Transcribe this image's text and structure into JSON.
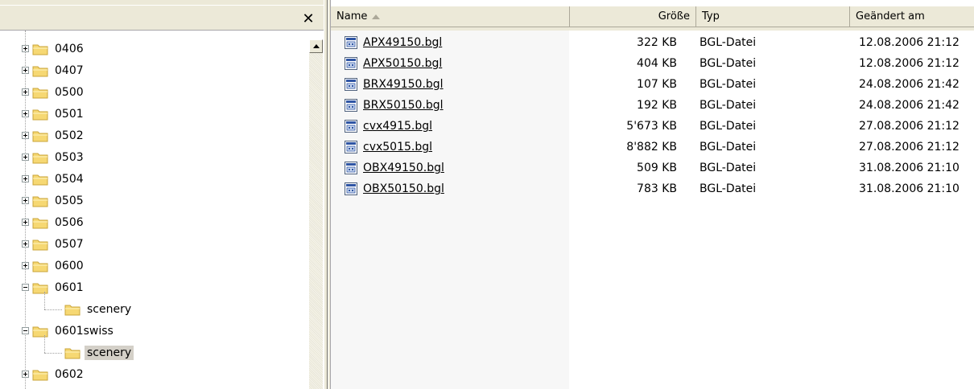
{
  "left_pane": {
    "close_glyph": "✕",
    "tree": [
      {
        "label": "0406",
        "expander": "plus"
      },
      {
        "label": "0407",
        "expander": "plus"
      },
      {
        "label": "0500",
        "expander": "plus"
      },
      {
        "label": "0501",
        "expander": "plus"
      },
      {
        "label": "0502",
        "expander": "plus"
      },
      {
        "label": "0503",
        "expander": "plus"
      },
      {
        "label": "0504",
        "expander": "plus"
      },
      {
        "label": "0505",
        "expander": "plus"
      },
      {
        "label": "0506",
        "expander": "plus"
      },
      {
        "label": "0507",
        "expander": "plus"
      },
      {
        "label": "0600",
        "expander": "plus"
      },
      {
        "label": "0601",
        "expander": "minus"
      },
      {
        "label": "scenery",
        "expander": "none",
        "child": true
      },
      {
        "label": "0601swiss",
        "expander": "minus"
      },
      {
        "label": "scenery",
        "expander": "none",
        "child": true,
        "selected": true
      },
      {
        "label": "0602",
        "expander": "plus"
      }
    ]
  },
  "file_list": {
    "columns": {
      "name": "Name",
      "size": "Größe",
      "type": "Typ",
      "modified": "Geändert am"
    },
    "files": [
      {
        "name": "APX49150.bgl",
        "size": "322 KB",
        "type": "BGL-Datei",
        "modified": "12.08.2006 21:12"
      },
      {
        "name": "APX50150.bgl",
        "size": "404 KB",
        "type": "BGL-Datei",
        "modified": "12.08.2006 21:12"
      },
      {
        "name": "BRX49150.bgl",
        "size": "107 KB",
        "type": "BGL-Datei",
        "modified": "24.08.2006 21:42"
      },
      {
        "name": "BRX50150.bgl",
        "size": "192 KB",
        "type": "BGL-Datei",
        "modified": "24.08.2006 21:42"
      },
      {
        "name": "cvx4915.bgl",
        "size": "5'673 KB",
        "type": "BGL-Datei",
        "modified": "27.08.2006 21:12"
      },
      {
        "name": "cvx5015.bgl",
        "size": "8'882 KB",
        "type": "BGL-Datei",
        "modified": "27.08.2006 21:12"
      },
      {
        "name": "OBX49150.bgl",
        "size": "509 KB",
        "type": "BGL-Datei",
        "modified": "31.08.2006 21:10"
      },
      {
        "name": "OBX50150.bgl",
        "size": "783 KB",
        "type": "BGL-Datei",
        "modified": "31.08.2006 21:10"
      }
    ]
  },
  "colors": {
    "folder_fill": "#f6d873",
    "folder_stroke": "#c9a43a",
    "selection": "#d4d0c8"
  }
}
